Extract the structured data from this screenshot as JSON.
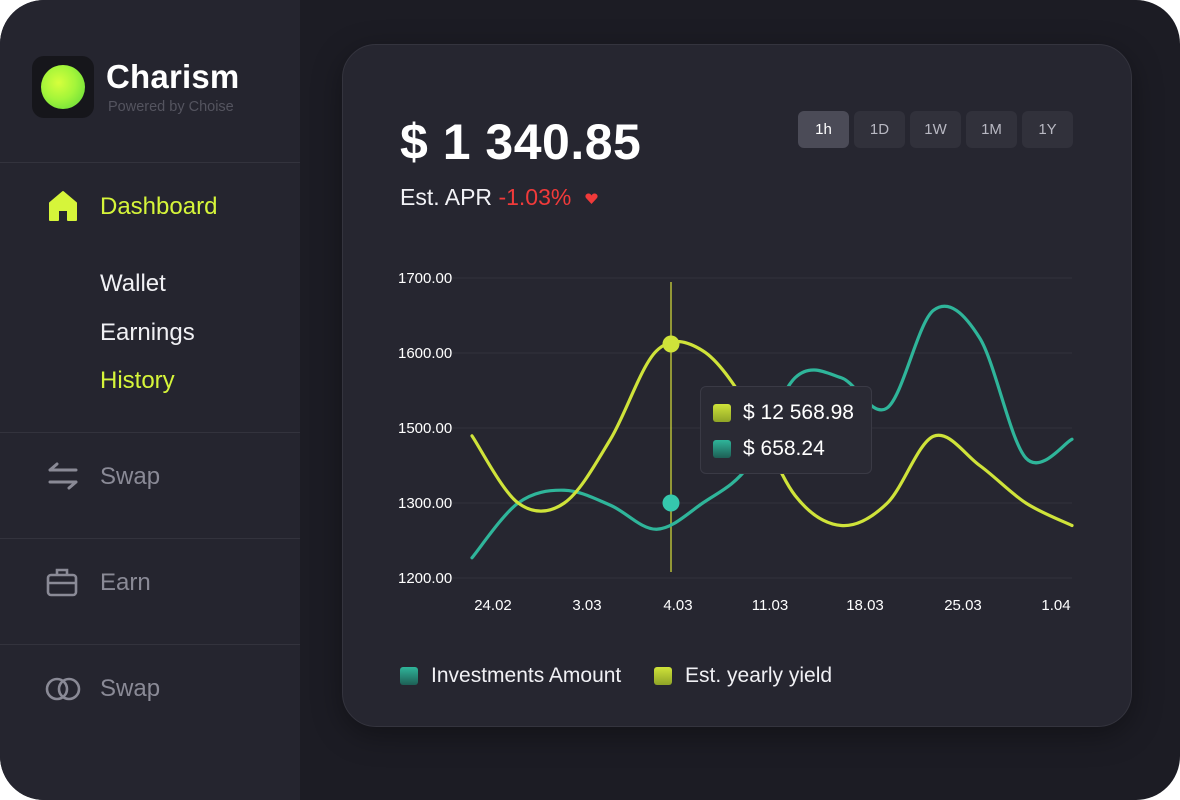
{
  "brand": {
    "name": "Charism",
    "subtitle": "Powered by Choise"
  },
  "nav": {
    "dashboard": "Dashboard",
    "sub_items": [
      "Wallet",
      "Earnings",
      "History"
    ],
    "swap": "Swap",
    "earn": "Earn",
    "swap2": "Swap"
  },
  "balance": {
    "amount": "$ 1 340.85",
    "apr_label": "Est. APR",
    "apr_value": "-1.03%"
  },
  "timeframes": {
    "items": [
      "1h",
      "1D",
      "1W",
      "1M",
      "1Y"
    ],
    "selected": "1h"
  },
  "colors": {
    "accent": "#d6f53a",
    "teal": "#2fb59a",
    "yield": "#cfe33a",
    "negative": "#f03a3a"
  },
  "tooltip": {
    "yield_value": "$ 12 568.98",
    "investment_value": "$ 658.24"
  },
  "chart_data": {
    "type": "line",
    "x": [
      "24.02",
      "3.03",
      "4.03",
      "11.03",
      "18.03",
      "25.03",
      "1.04"
    ],
    "x_ticks": [
      "24.02",
      "3.03",
      "4.03",
      "11.03",
      "18.03",
      "25.03",
      "1.04"
    ],
    "y_ticks": [
      "1700.00",
      "1600.00",
      "1500.00",
      "1300.00",
      "1200.00"
    ],
    "series": [
      {
        "name": "Investments Amount",
        "color": "#2fb59a",
        "values": [
          1227,
          1300,
          1334,
          1297,
          1265,
          1300,
          1400,
          1567,
          1567,
          1527,
          1657,
          1620,
          1420,
          1470
        ]
      },
      {
        "name": "Est. yearly yield",
        "color": "#cfe33a",
        "values": [
          1479,
          1300,
          1300,
          1470,
          1603,
          1603,
          1527,
          1320,
          1270,
          1300,
          1478,
          1400,
          1300,
          1270
        ]
      }
    ],
    "highlight_x_index": 2
  },
  "legend": [
    {
      "label": "Investments Amount"
    },
    {
      "label": "Est. yearly yield"
    }
  ]
}
